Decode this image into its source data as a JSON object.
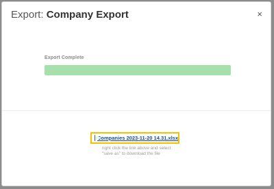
{
  "modal": {
    "title_prefix": "Export:",
    "title_name": "Company Export",
    "close_label": "×"
  },
  "export": {
    "status_label": "Export Complete",
    "progress": 1.0
  },
  "download": {
    "file_icon": "excel-file-icon",
    "filename": "Companies 2023-11-20 14.31.xlsx",
    "hint_line1": "right click the link above and select",
    "hint_line2": "\"save as\" to download the file"
  },
  "colors": {
    "progress_fill": "#a6e0ab",
    "highlight_border": "#f2c200",
    "link": "#1a4f8b"
  }
}
